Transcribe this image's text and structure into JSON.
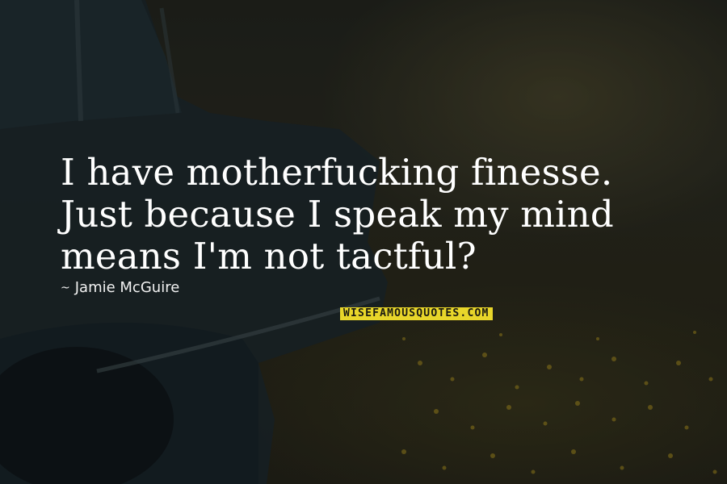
{
  "quote": {
    "text": "I have motherfucking finesse. Just because I speak my mind means I'm not tactful?"
  },
  "author": {
    "dash": "~",
    "name": "Jamie McGuire"
  },
  "watermark": {
    "text": "WISEFAMOUSQUOTES.COM",
    "color": "#e8d62a"
  },
  "colors": {
    "quote_text": "#ffffff",
    "background_dark": "#24261f"
  }
}
